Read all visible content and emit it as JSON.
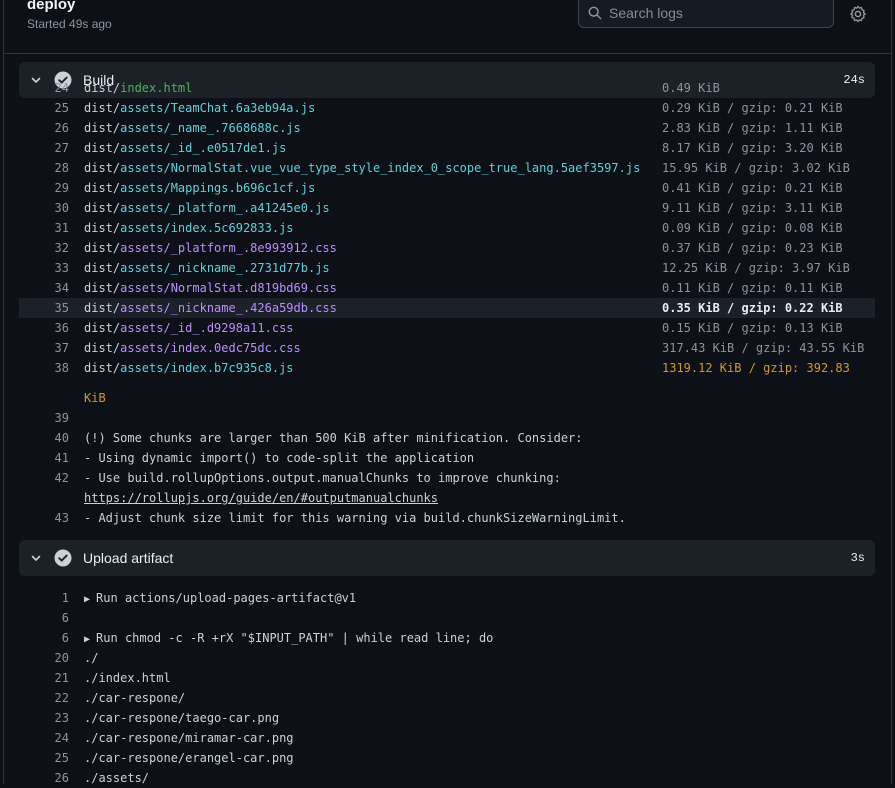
{
  "job": {
    "title": "deploy",
    "subtitle": "Started 49s ago"
  },
  "search": {
    "placeholder": "Search logs"
  },
  "steps": [
    {
      "name": "Build",
      "duration": "24s"
    },
    {
      "name": "Upload artifact",
      "duration": "3s"
    }
  ],
  "build_lines": [
    {
      "num": "24",
      "prefix": "dist/",
      "path": "index.html",
      "cls": "green",
      "size": "0.49 KiB"
    },
    {
      "num": "25",
      "prefix": "dist/",
      "path": "assets/TeamChat.6a3eb94a.js",
      "cls": "cyan",
      "size": "0.29 KiB / gzip: 0.21 KiB"
    },
    {
      "num": "26",
      "prefix": "dist/",
      "path": "assets/_name_.7668688c.js",
      "cls": "cyan",
      "size": "2.83 KiB / gzip: 1.11 KiB"
    },
    {
      "num": "27",
      "prefix": "dist/",
      "path": "assets/_id_.e0517de1.js",
      "cls": "cyan",
      "size": "8.17 KiB / gzip: 3.20 KiB"
    },
    {
      "num": "28",
      "prefix": "dist/",
      "path": "assets/NormalStat.vue_vue_type_style_index_0_scope_true_lang.5aef3597.js",
      "cls": "cyan",
      "size": "15.95 KiB / gzip: 3.02 KiB"
    },
    {
      "num": "29",
      "prefix": "dist/",
      "path": "assets/Mappings.b696c1cf.js",
      "cls": "cyan",
      "size": "0.41 KiB / gzip: 0.21 KiB"
    },
    {
      "num": "30",
      "prefix": "dist/",
      "path": "assets/_platform_.a41245e0.js",
      "cls": "cyan",
      "size": "9.11 KiB / gzip: 3.11 KiB"
    },
    {
      "num": "31",
      "prefix": "dist/",
      "path": "assets/index.5c692833.js",
      "cls": "cyan",
      "size": "0.09 KiB / gzip: 0.08 KiB"
    },
    {
      "num": "32",
      "prefix": "dist/",
      "path": "assets/_platform_.8e993912.css",
      "cls": "purple",
      "size": "0.37 KiB / gzip: 0.23 KiB"
    },
    {
      "num": "33",
      "prefix": "dist/",
      "path": "assets/_nickname_.2731d77b.js",
      "cls": "cyan",
      "size": "12.25 KiB / gzip: 3.97 KiB"
    },
    {
      "num": "34",
      "prefix": "dist/",
      "path": "assets/NormalStat.d819bd69.css",
      "cls": "purple",
      "size": "0.11 KiB / gzip: 0.11 KiB"
    },
    {
      "num": "35",
      "prefix": "dist/",
      "path": "assets/_nickname_.426a59db.css",
      "cls": "purple",
      "size": "0.35 KiB / gzip: 0.22 KiB"
    },
    {
      "num": "36",
      "prefix": "dist/",
      "path": "assets/_id_.d9298a11.css",
      "cls": "purple",
      "size": "0.15 KiB / gzip: 0.13 KiB"
    },
    {
      "num": "37",
      "prefix": "dist/",
      "path": "assets/index.0edc75dc.css",
      "cls": "purple",
      "size": "317.43 KiB / gzip: 43.55 KiB"
    },
    {
      "num": "38",
      "prefix": "dist/",
      "path": "assets/index.b7c935c8.js",
      "cls": "cyan",
      "size": "1319.12 KiB / gzip: 392.83"
    }
  ],
  "build_tail": {
    "l38_cont": "KiB",
    "l39": "39",
    "l40_num": "40",
    "l40": "(!) Some chunks are larger than 500 KiB after minification. Consider:",
    "l41_num": "41",
    "l41": "- Using dynamic import() to code-split the application",
    "l42_num": "42",
    "l42": "- Use build.rollupOptions.output.manualChunks to improve chunking:",
    "l42_link": "https://rollupjs.org/guide/en/#outputmanualchunks",
    "l43_num": "43",
    "l43": "- Adjust chunk size limit for this warning via build.chunkSizeWarningLimit."
  },
  "upload_lines": [
    {
      "num": "1",
      "text": "Run actions/upload-pages-artifact@v1",
      "group": true
    },
    {
      "num": "6",
      "text": "",
      "group": false
    },
    {
      "num": "6",
      "text": "Run chmod -c -R +rX \"$INPUT_PATH\" | while read line; do",
      "group": true
    },
    {
      "num": "20",
      "text": "./",
      "group": false
    },
    {
      "num": "21",
      "text": "./index.html",
      "group": false
    },
    {
      "num": "22",
      "text": "./car-respone/",
      "group": false
    },
    {
      "num": "23",
      "text": "./car-respone/taego-car.png",
      "group": false
    },
    {
      "num": "24",
      "text": "./car-respone/miramar-car.png",
      "group": false
    },
    {
      "num": "25",
      "text": "./car-respone/erangel-car.png",
      "group": false
    },
    {
      "num": "26",
      "text": "./assets/",
      "group": false
    }
  ],
  "colors": {
    "bg": "#0d1117",
    "step_bg": "#1c2128",
    "success": "#c9d1d9",
    "warn": "#d29922"
  },
  "icons": {
    "search": "search-icon",
    "settings": "gear-icon",
    "expand": "chevron-down-icon",
    "status": "check-circle-icon",
    "group": "triangle-right-icon"
  }
}
